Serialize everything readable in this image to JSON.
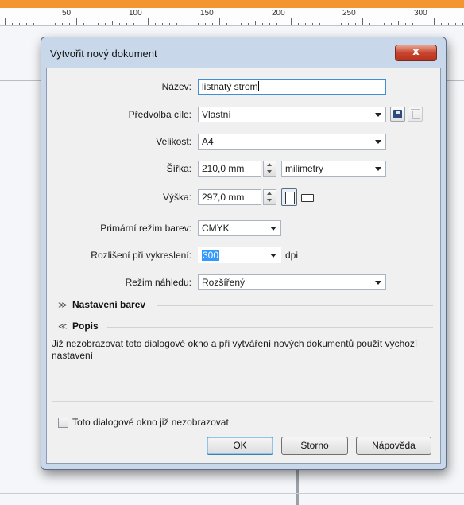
{
  "ruler": {
    "labels": [
      "50",
      "100",
      "150",
      "200",
      "250",
      "300"
    ]
  },
  "dialog": {
    "title": "Vytvořit nový dokument",
    "close_label": "x",
    "fields": {
      "name_label": "Název:",
      "name_value": "listnatý strom",
      "preset_label": "Předvolba cíle:",
      "preset_value": "Vlastní",
      "size_label": "Velikost:",
      "size_value": "A4",
      "width_label": "Šířka:",
      "width_value": "210,0 mm",
      "units_value": "milimetry",
      "height_label": "Výška:",
      "height_value": "297,0 mm",
      "color_mode_label": "Primární režim barev:",
      "color_mode_value": "CMYK",
      "resolution_label": "Rozlišení při vykreslení:",
      "resolution_value": "300",
      "resolution_unit": "dpi",
      "preview_label": "Režim náhledu:",
      "preview_value": "Rozšířený"
    },
    "sections": {
      "color_settings": "Nastavení barev",
      "description": "Popis",
      "description_text": "Již nezobrazovat toto dialogové okno a při vytváření nových dokumentů použít výchozí nastavení"
    },
    "checkbox_label": "Toto dialogové okno již nezobrazovat",
    "buttons": {
      "ok": "OK",
      "cancel": "Storno",
      "help": "Nápověda"
    },
    "icons": {
      "close": "close-icon",
      "save_preset": "save-icon",
      "delete_preset": "delete-icon",
      "portrait": "portrait-icon",
      "landscape": "landscape-icon"
    }
  }
}
